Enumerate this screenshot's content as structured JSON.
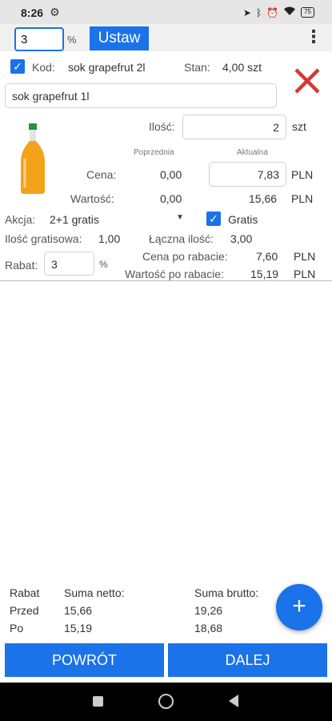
{
  "status": {
    "time": "8:26",
    "battery": "75"
  },
  "toolbar": {
    "percent_value": "3",
    "percent_sign": "%",
    "set_label": "Ustaw"
  },
  "product": {
    "code_label": "Kod:",
    "code_value": "sok grapefrut 2l",
    "stock_label": "Stan:",
    "stock_value": "4,00 szt",
    "name_value": "sok grapefrut 1l",
    "qty_label": "Ilość:",
    "qty_value": "2",
    "qty_unit": "szt",
    "prev_header": "Poprzednia",
    "current_header": "Aktualna",
    "price_label": "Cena:",
    "price_prev": "0,00",
    "price_current": "7,83",
    "price_currency": "PLN",
    "value_label": "Wartość:",
    "value_prev": "0,00",
    "value_current": "15,66",
    "value_currency": "PLN",
    "promo_label": "Akcja:",
    "promo_value": "2+1 gratis",
    "gratis_label": "Gratis",
    "free_qty_label": "Ilość gratisowa:",
    "free_qty_value": "1,00",
    "total_qty_label": "Łączna ilość:",
    "total_qty_value": "3,00",
    "discount_label": "Rabat:",
    "discount_value": "3",
    "discount_sign": "%",
    "disc_price_label": "Cena po rabacie:",
    "disc_price_value": "7,60",
    "disc_price_currency": "PLN",
    "disc_value_label": "Wartość po rabacie:",
    "disc_value_value": "15,19",
    "disc_value_currency": "PLN"
  },
  "summary": {
    "col_rabat": "Rabat",
    "col_net": "Suma netto:",
    "col_gross": "Suma brutto:",
    "row_before": "Przed",
    "before_net": "15,66",
    "before_gross": "19,26",
    "row_after": "Po",
    "after_net": "15,19",
    "after_gross": "18,68"
  },
  "buttons": {
    "fab": "+",
    "back": "POWRÓT",
    "next": "DALEJ"
  }
}
